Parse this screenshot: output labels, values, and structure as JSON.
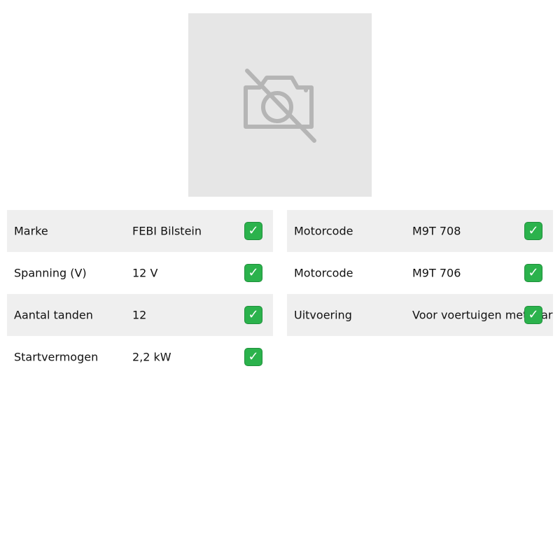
{
  "image": {
    "icon": "no-photo-camera-icon"
  },
  "left_table": [
    {
      "label": "Marke",
      "value": "FEBI Bilstein",
      "check_icon": "check-mark-icon"
    },
    {
      "label": "Spanning (V)",
      "value": "12 V",
      "check_icon": "check-mark-icon"
    },
    {
      "label": "Aantal tanden",
      "value": "12",
      "check_icon": "check-mark-icon"
    },
    {
      "label": "Startvermogen",
      "value": "2,2 kW",
      "check_icon": "check-mark-icon"
    }
  ],
  "right_table": [
    {
      "label": "Motorcode",
      "value": "M9T 708",
      "check_icon": "check-mark-icon"
    },
    {
      "label": "Motorcode",
      "value": "M9T 706",
      "check_icon": "check-mark-icon"
    },
    {
      "label": "Uitvoering",
      "value": "Voor voertuigen met start/",
      "check_icon": "check-mark-icon"
    }
  ],
  "colors": {
    "row_shade": "#efefef",
    "check_green": "#2bb24c",
    "image_placeholder_bg": "#e6e6e6",
    "icon_gray": "#b5b5b5"
  }
}
